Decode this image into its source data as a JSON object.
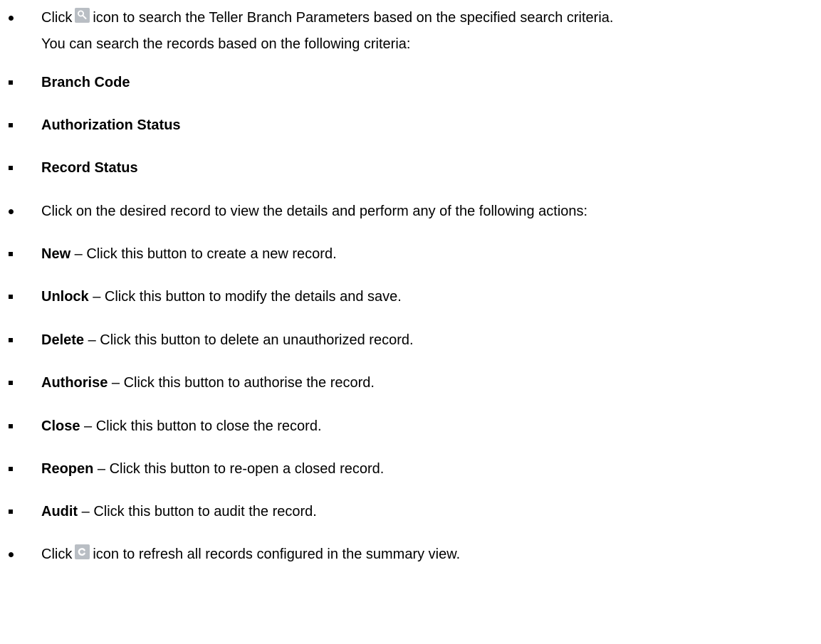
{
  "intro": {
    "search_before": "Click",
    "search_icon": "search-icon",
    "search_after": "icon to search the Teller Branch Parameters based on the specified search criteria.",
    "search_line2": "You can search the records based on the following criteria:"
  },
  "criteria": [
    {
      "label": "Branch Code"
    },
    {
      "label": "Authorization Status"
    },
    {
      "label": "Record Status"
    }
  ],
  "record_intro": "Click on the desired record to view the details and perform any of the following actions:",
  "actions": [
    {
      "label": "New",
      "desc": " – Click this button to create a new record."
    },
    {
      "label": "Unlock",
      "desc": " – Click this button to modify the details and save."
    },
    {
      "label": "Delete",
      "desc": " – Click this button to delete an unauthorized record."
    },
    {
      "label": "Authorise",
      "desc": " – Click this button to authorise the record."
    },
    {
      "label": "Close",
      "desc": " – Click this button to close the record."
    },
    {
      "label": "Reopen",
      "desc": " – Click this button to re-open a closed record."
    },
    {
      "label": "Audit",
      "desc": " – Click this button to audit the record."
    }
  ],
  "refresh": {
    "before": "Click",
    "icon": "refresh-icon",
    "after": "icon to refresh all records configured in the summary view."
  }
}
